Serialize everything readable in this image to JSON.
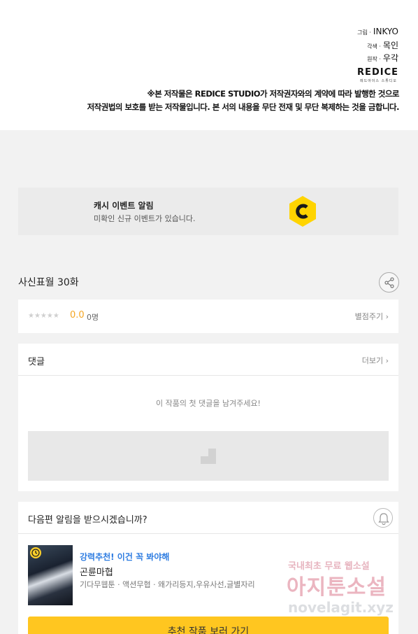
{
  "credits": {
    "art_label": "그림 ·",
    "art_value": "INKYO",
    "adapt_label": "각색 ·",
    "adapt_value": "목인",
    "original_label": "원작 ·",
    "original_value": "우각",
    "logo_text": "REDICE",
    "logo_sub": "레드아이스 스튜디오",
    "notice_line1": "※본 저작물은 REDICE STUDIO가 저작권자와의 계약에 따라 발행한 것으로",
    "notice_line2": "저작권법의 보호를 받는 저작물입니다. 본 서의 내용을 무단 전재 및 무단 복제하는 것을 금합니다."
  },
  "cash_event": {
    "title": "캐시 이벤트 알림",
    "description": "미확인 신규 이벤트가 있습니다.",
    "icon": "cash-c-icon",
    "accent_color": "#ffd400"
  },
  "episode": {
    "title": "사신표월 30화",
    "share_icon": "share-icon"
  },
  "rating": {
    "stars": "★★★★★",
    "score": "0.0",
    "raters": "0명",
    "rate_link": "별점주기 ›",
    "score_color": "#f5a623"
  },
  "comments": {
    "title": "댓글",
    "more_link": "더보기 ›",
    "empty_message": "이 작품의 첫 댓글을 남겨주세요!"
  },
  "next_episode": {
    "question": "다음편 알림을 받으시겠습니까?",
    "bell_icon": "bell-icon"
  },
  "recommendation": {
    "tag": "강력추천! 이건 꼭 봐야해",
    "title": "곤륜마협",
    "genres": "기다무웹툰 · 액션무협 · 왜가리등지,우유사선,글별자리",
    "cta_label": "추천 작품 보러 가기",
    "tag_color": "#2f7de1",
    "cta_color": "#ffc620"
  },
  "watermark": {
    "line1": "국내최초 무료 웹소설",
    "line2": "아지툰소설",
    "line3": "novelagit.xyz"
  }
}
